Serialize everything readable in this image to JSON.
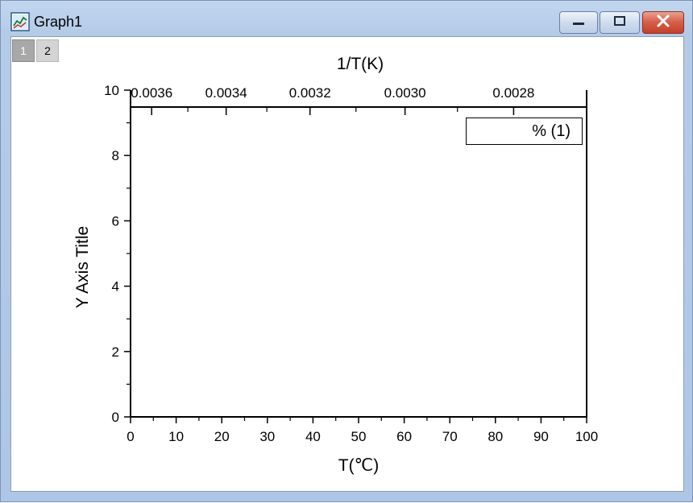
{
  "window": {
    "title": "Graph1",
    "icons": {
      "app": "graph-app-icon",
      "minimize": "minimize-icon",
      "maximize": "maximize-icon",
      "close": "close-icon"
    },
    "close_color": "#c2402c"
  },
  "layers": [
    {
      "label": "1",
      "active": true
    },
    {
      "label": "2",
      "active": false
    }
  ],
  "chart_data": {
    "type": "scatter",
    "series": [],
    "xlabel": "T(℃)",
    "ylabel": "Y Axis Title",
    "top_xlabel": "1/T(K)",
    "xlim": [
      0,
      100
    ],
    "ylim": [
      0,
      10
    ],
    "x_ticks": [
      "0",
      "10",
      "20",
      "30",
      "40",
      "50",
      "60",
      "70",
      "80",
      "90",
      "100"
    ],
    "y_ticks": [
      "0",
      "2",
      "4",
      "6",
      "8",
      "10"
    ],
    "top_ticks": [
      "0.0036",
      "0.0034",
      "0.0032",
      "0.0030",
      "0.0028"
    ],
    "grid": false,
    "legend": {
      "text": "% (1)",
      "placement": "top-right"
    }
  }
}
